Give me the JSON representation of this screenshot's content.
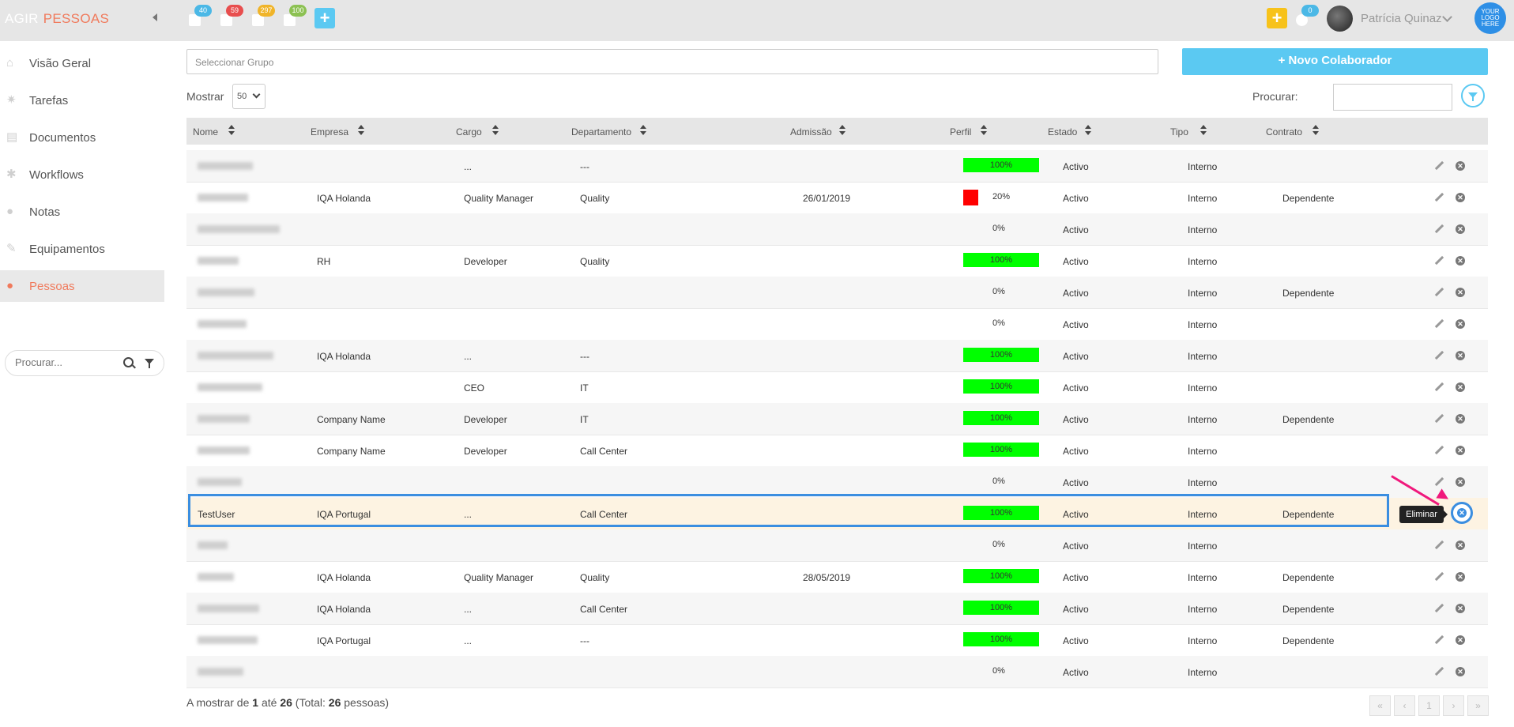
{
  "brand": {
    "part1": "AGIR",
    "part2": "PESSOAS"
  },
  "topbar": {
    "badges": [
      {
        "icon": "calendar-icon",
        "count": "40",
        "color": "#4bb8e6"
      },
      {
        "icon": "gear-icon",
        "count": "59",
        "color": "#e84e4e"
      },
      {
        "icon": "document-icon",
        "count": "297",
        "color": "#f0b429"
      },
      {
        "icon": "bell-icon",
        "count": "100",
        "color": "#8cc152"
      }
    ],
    "add_symbol": "+",
    "quick_add_symbol": "+",
    "messages_count": "0",
    "user_name": "Patrícia Quinaz",
    "logo_text": "YOUR LOGO HERE"
  },
  "sidebar": {
    "items": [
      {
        "label": "Visão Geral",
        "icon": "home-icon",
        "glyph": "⌂"
      },
      {
        "label": "Tarefas",
        "icon": "gear-icon",
        "glyph": "✷"
      },
      {
        "label": "Documentos",
        "icon": "file-icon",
        "glyph": "▤"
      },
      {
        "label": "Workflows",
        "icon": "cogs-icon",
        "glyph": "✱"
      },
      {
        "label": "Notas",
        "icon": "chat-icon",
        "glyph": "●"
      },
      {
        "label": "Equipamentos",
        "icon": "wrench-icon",
        "glyph": "✎"
      },
      {
        "label": "Pessoas",
        "icon": "user-icon",
        "glyph": "●"
      }
    ],
    "search_placeholder": "Procurar..."
  },
  "toolbar": {
    "group_placeholder": "Seleccionar Grupo",
    "new_button": "+ Novo Colaborador",
    "show_label": "Mostrar",
    "show_value": "50",
    "search_label": "Procurar:"
  },
  "table": {
    "columns": [
      "Nome",
      "Empresa",
      "Cargo",
      "Departamento",
      "Admissão",
      "Perfil",
      "Estado",
      "Tipo",
      "Contrato"
    ],
    "rows": [
      {
        "nome": "",
        "empresa": "",
        "cargo": "...",
        "departamento": "---",
        "admissao": "",
        "perfil": "100%",
        "perfil_pct": 100,
        "estado": "Activo",
        "tipo": "Interno",
        "contrato": ""
      },
      {
        "nome": "",
        "empresa": "IQA Holanda",
        "cargo": "Quality Manager",
        "departamento": "Quality",
        "admissao": "26/01/2019",
        "perfil": "20%",
        "perfil_pct": 20,
        "estado": "Activo",
        "tipo": "Interno",
        "contrato": "Dependente"
      },
      {
        "nome": "",
        "empresa": "",
        "cargo": "",
        "departamento": "",
        "admissao": "",
        "perfil": "0%",
        "perfil_pct": 0,
        "estado": "Activo",
        "tipo": "Interno",
        "contrato": ""
      },
      {
        "nome": "",
        "empresa": "RH",
        "cargo": "Developer",
        "departamento": "Quality",
        "admissao": "",
        "perfil": "100%",
        "perfil_pct": 100,
        "estado": "Activo",
        "tipo": "Interno",
        "contrato": ""
      },
      {
        "nome": "",
        "empresa": "",
        "cargo": "",
        "departamento": "",
        "admissao": "",
        "perfil": "0%",
        "perfil_pct": 0,
        "estado": "Activo",
        "tipo": "Interno",
        "contrato": "Dependente"
      },
      {
        "nome": "",
        "empresa": "",
        "cargo": "",
        "departamento": "",
        "admissao": "",
        "perfil": "0%",
        "perfil_pct": 0,
        "estado": "Activo",
        "tipo": "Interno",
        "contrato": ""
      },
      {
        "nome": "",
        "empresa": "IQA Holanda",
        "cargo": "...",
        "departamento": "---",
        "admissao": "",
        "perfil": "100%",
        "perfil_pct": 100,
        "estado": "Activo",
        "tipo": "Interno",
        "contrato": ""
      },
      {
        "nome": "",
        "empresa": "",
        "cargo": "CEO",
        "departamento": "IT",
        "admissao": "",
        "perfil": "100%",
        "perfil_pct": 100,
        "estado": "Activo",
        "tipo": "Interno",
        "contrato": ""
      },
      {
        "nome": "",
        "empresa": "Company Name",
        "cargo": "Developer",
        "departamento": "IT",
        "admissao": "",
        "perfil": "100%",
        "perfil_pct": 100,
        "estado": "Activo",
        "tipo": "Interno",
        "contrato": "Dependente"
      },
      {
        "nome": "",
        "empresa": "Company Name",
        "cargo": "Developer",
        "departamento": "Call Center",
        "admissao": "",
        "perfil": "100%",
        "perfil_pct": 100,
        "estado": "Activo",
        "tipo": "Interno",
        "contrato": ""
      },
      {
        "nome": "",
        "empresa": "",
        "cargo": "",
        "departamento": "",
        "admissao": "",
        "perfil": "0%",
        "perfil_pct": 0,
        "estado": "Activo",
        "tipo": "Interno",
        "contrato": ""
      },
      {
        "nome": "TestUser",
        "empresa": "IQA Portugal",
        "cargo": "...",
        "departamento": "Call Center",
        "admissao": "",
        "perfil": "100%",
        "perfil_pct": 100,
        "estado": "Activo",
        "tipo": "Interno",
        "contrato": "Dependente"
      },
      {
        "nome": "",
        "empresa": "",
        "cargo": "",
        "departamento": "",
        "admissao": "",
        "perfil": "0%",
        "perfil_pct": 0,
        "estado": "Activo",
        "tipo": "Interno",
        "contrato": ""
      },
      {
        "nome": "",
        "empresa": "IQA Holanda",
        "cargo": "Quality Manager",
        "departamento": "Quality",
        "admissao": "28/05/2019",
        "perfil": "100%",
        "perfil_pct": 100,
        "estado": "Activo",
        "tipo": "Interno",
        "contrato": "Dependente"
      },
      {
        "nome": "",
        "empresa": "IQA Holanda",
        "cargo": "...",
        "departamento": "Call Center",
        "admissao": "",
        "perfil": "100%",
        "perfil_pct": 100,
        "estado": "Activo",
        "tipo": "Interno",
        "contrato": "Dependente"
      },
      {
        "nome": "",
        "empresa": "IQA Portugal",
        "cargo": "...",
        "departamento": "---",
        "admissao": "",
        "perfil": "100%",
        "perfil_pct": 100,
        "estado": "Activo",
        "tipo": "Interno",
        "contrato": "Dependente"
      },
      {
        "nome": "",
        "empresa": "",
        "cargo": "",
        "departamento": "",
        "admissao": "",
        "perfil": "0%",
        "perfil_pct": 0,
        "estado": "Activo",
        "tipo": "Interno",
        "contrato": ""
      }
    ]
  },
  "tooltip": "Eliminar",
  "footer": {
    "prefix": "A mostrar de",
    "from": "1",
    "mid": "até",
    "to": "26",
    "total_prefix": "(Total:",
    "total": "26",
    "total_suffix": "pessoas)"
  },
  "pager": [
    "«",
    "‹",
    "1",
    "›",
    "»"
  ],
  "colors": {
    "accent": "#5bc9f2",
    "brand": "#f07a5c",
    "bar": "#00ff00",
    "bar_low": "#ff0000",
    "highlight": "#3b8ee0",
    "annotation_arrow": "#f0197c"
  }
}
